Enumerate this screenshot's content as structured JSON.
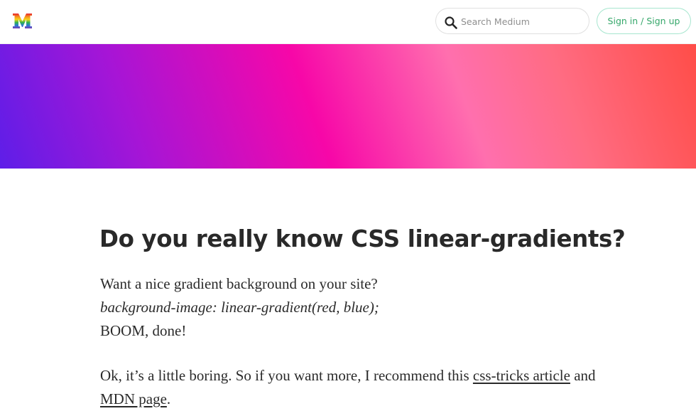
{
  "header": {
    "logo": "medium-logo",
    "search_placeholder": "Search Medium",
    "signin_label": "Sign in / Sign up"
  },
  "article": {
    "title": "Do you really know CSS linear-gradients?",
    "line1": "Want a nice gradient background on your site?",
    "line2": "background-image: linear-gradient(red, blue);",
    "line3": "BOOM, done!",
    "para2_prefix": "Ok, it’s a little boring. So if you want more, I recommend this",
    "link_css_tricks": "css-tricks article",
    "para2_middle": "and",
    "link_mdn": "MDN page",
    "para2_suffix": "."
  },
  "colors": {
    "accent_green": "#35a76a",
    "gradient_start": "#5e1ee8",
    "gradient_mid": "#f707a8",
    "gradient_end": "#ff4d48"
  }
}
